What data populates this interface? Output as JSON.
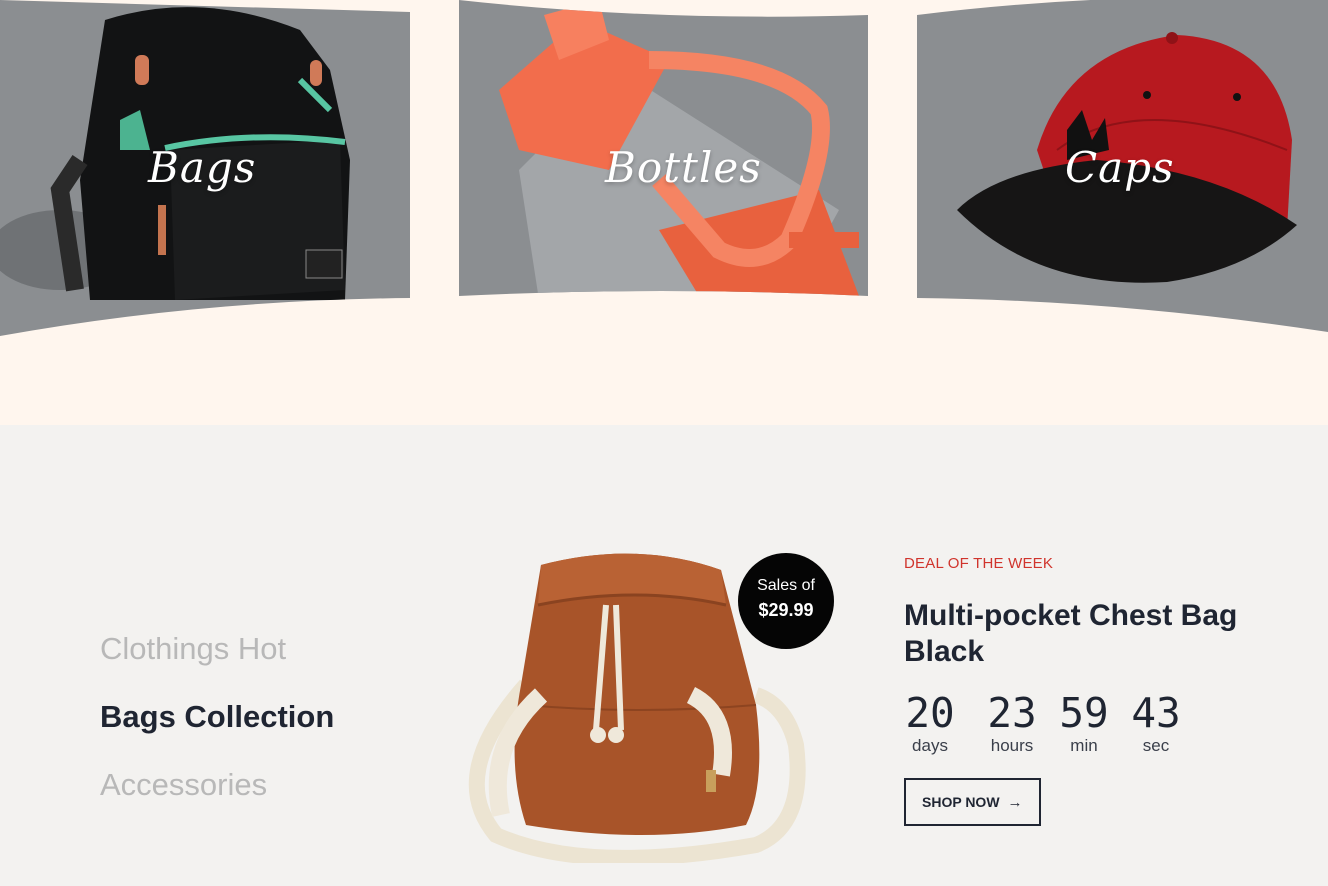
{
  "categories": [
    {
      "label": "Bags",
      "image": "black-backpack"
    },
    {
      "label": "Bottles",
      "image": "orange-water-bottle"
    },
    {
      "label": "Caps",
      "image": "red-baseball-cap"
    }
  ],
  "deal_tabs": [
    {
      "label": "Clothings Hot",
      "active": false
    },
    {
      "label": "Bags Collection",
      "active": true
    },
    {
      "label": "Accessories",
      "active": false
    }
  ],
  "sale_badge": {
    "line1": "Sales of",
    "price": "$29.99"
  },
  "deal": {
    "eyebrow": "DEAL OF THE WEEK",
    "title": "Multi-pocket Chest Bag Black",
    "countdown": [
      {
        "value": "20",
        "label": "days"
      },
      {
        "value": "23",
        "label": "hours"
      },
      {
        "value": "59",
        "label": "min"
      },
      {
        "value": "43",
        "label": "sec"
      }
    ],
    "button_label": "SHOP NOW",
    "button_icon": "arrow-right-icon"
  },
  "colors": {
    "page_bg": "#fff6ee",
    "section_bg": "#f3f2f0",
    "card_overlay": "#8b8e91",
    "accent_red": "#d0342c",
    "text_dark": "#1f2532",
    "text_muted": "#b8b8b8"
  }
}
